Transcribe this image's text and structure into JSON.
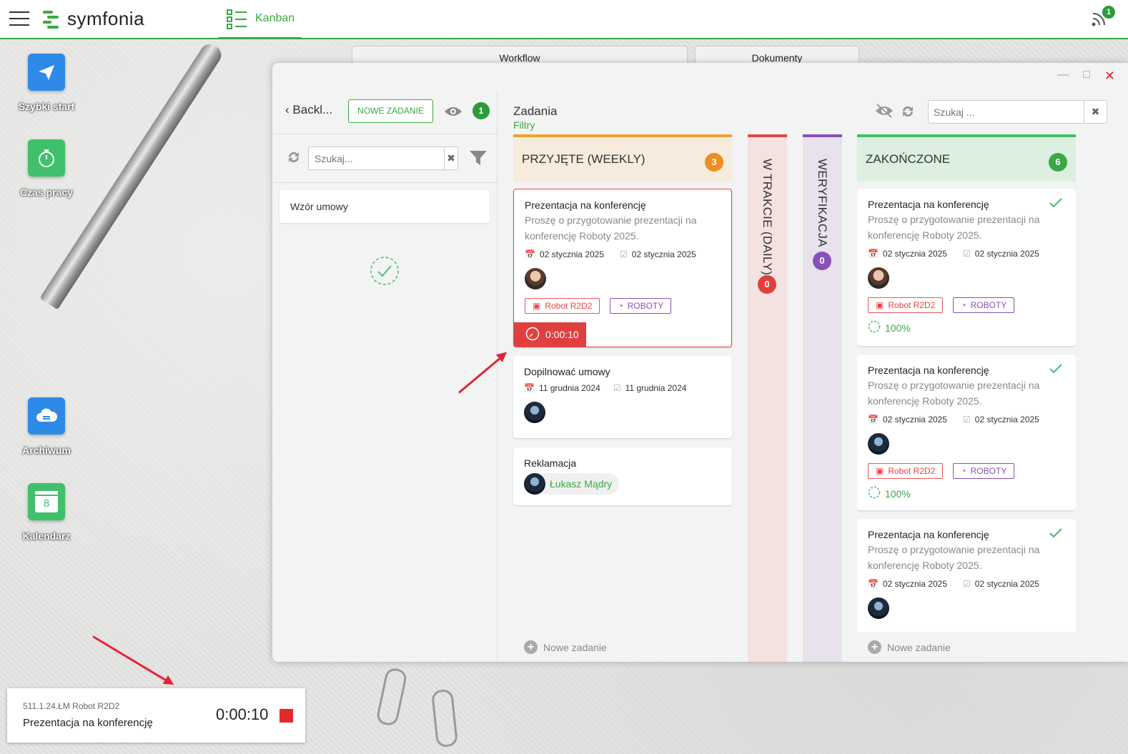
{
  "app": {
    "logo_text": "symfonia",
    "active_tab": "Kanban",
    "notification_count": "1"
  },
  "desktop_icons": [
    {
      "label": "Szybki start",
      "color": "#2d8ae6"
    },
    {
      "label": "Czas pracy",
      "color": "#3fc06a"
    },
    {
      "label": "Archiwum",
      "color": "#2d8ae6"
    },
    {
      "label": "Kalendarz",
      "color": "#3fc06a",
      "calendar_day": "8"
    }
  ],
  "background_tabs": [
    "Workflow",
    "Dokumenty"
  ],
  "backlog": {
    "back_label": "Backl...",
    "new_task_label": "NOWE ZADANIE",
    "visible_count": "1",
    "search_placeholder": "Szukaj...",
    "items": [
      "Wzór umowy"
    ]
  },
  "board": {
    "title": "Zadania",
    "filters_label": "Filtry",
    "search_placeholder": "Szukaj ...",
    "new_task_link": "Nowe zadanie",
    "columns": [
      {
        "name": "PRZYJĘTE (WEEKLY)",
        "count": "3",
        "accent": "#f0a030",
        "header_bg": "#f6ebdc",
        "badge": "#ef8c22"
      },
      {
        "name": "W TRAKCIE (DAILY)",
        "count": "0",
        "accent": "#e04848",
        "bg": "#f3e2e0",
        "badge": "#e03f3f"
      },
      {
        "name": "WERYFIKACJA",
        "count": "0",
        "accent": "#8a4fb8",
        "bg": "#e8e2ec",
        "badge": "#8a4fb8"
      },
      {
        "name": "ZAKOŃCZONE",
        "count": "6",
        "accent": "#3fc06a",
        "header_bg": "#dcefe0",
        "badge": "#3aa845"
      }
    ],
    "accepted_cards": [
      {
        "title": "Prezentacja na konferencję",
        "desc1": "Proszę o przygotowanie prezentacji na",
        "desc2": "konferencję Roboty 2025.",
        "start": "02 stycznia 2025",
        "end": "02 stycznia 2025",
        "tag1": "Robot R2D2",
        "tag2": "ROBOTY",
        "timer": "0:00:10"
      },
      {
        "title": "Dopilnować umowy",
        "start": "11 grudnia 2024",
        "end": "11 grudnia 2024"
      },
      {
        "title": "Reklamacja",
        "person": "Łukasz Mądry"
      }
    ],
    "done_cards": [
      {
        "title": "Prezentacja na konferencję",
        "desc1": "Proszę o przygotowanie prezentacji na",
        "desc2": "konferencję Roboty 2025.",
        "start": "02 stycznia 2025",
        "end": "02 stycznia 2025",
        "tag1": "Robot R2D2",
        "tag2": "ROBOTY",
        "progress": "100%"
      },
      {
        "title": "Prezentacja na konferencję",
        "desc1": "Proszę o przygotowanie prezentacji na",
        "desc2": "konferencję Roboty 2025.",
        "start": "02 stycznia 2025",
        "end": "02 stycznia 2025",
        "tag1": "Robot R2D2",
        "tag2": "ROBOTY",
        "progress": "100%"
      },
      {
        "title": "Prezentacja na konferencję",
        "desc1": "Proszę o przygotowanie prezentacji na",
        "desc2": "konferencję Roboty 2025.",
        "start": "02 stycznia 2025",
        "end": "02 stycznia 2025"
      }
    ]
  },
  "timer_widget": {
    "code": "511.1.24.ŁM Robot R2D2",
    "task": "Prezentacja na konferencję",
    "time": "0:00:10"
  }
}
